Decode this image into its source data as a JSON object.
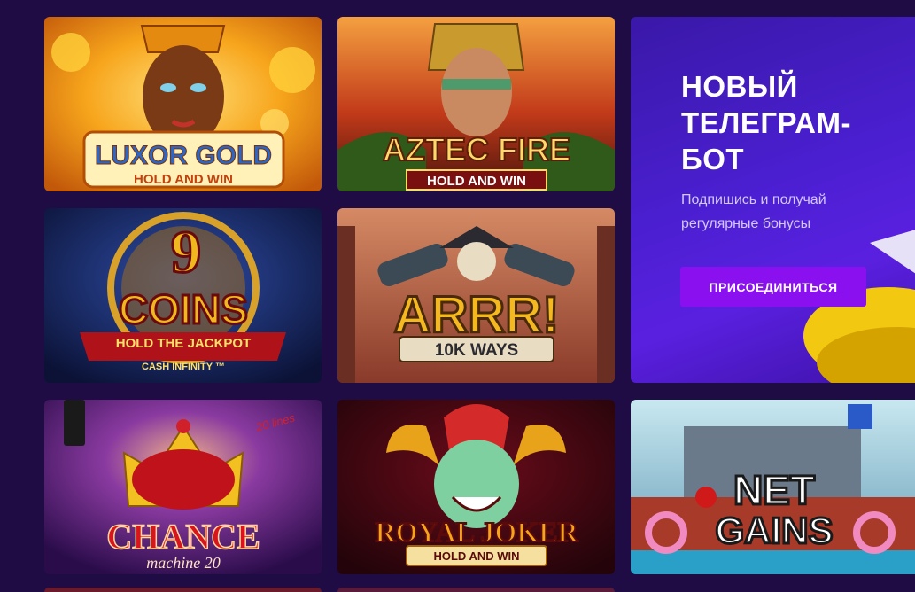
{
  "games": [
    {
      "id": "luxor-gold",
      "title": "LUXOR GOLD",
      "subtitle": "HOLD AND WIN"
    },
    {
      "id": "aztec-fire",
      "title": "AZTEC FIRE",
      "subtitle": "HOLD AND WIN"
    },
    {
      "id": "9-coins",
      "title_top": "9",
      "title": "COINS",
      "subtitle": "HOLD THE JACKPOT",
      "extra": "CASH INFINITY ™"
    },
    {
      "id": "arrr",
      "title": "ARRR!",
      "subtitle": "10K WAYS"
    },
    {
      "id": "chance-machine-20",
      "title": "CHANCE",
      "subtitle": "machine 20",
      "badge": "20 lines"
    },
    {
      "id": "royal-joker",
      "title": "ROYAL JOKER",
      "subtitle": "HOLD AND WIN"
    },
    {
      "id": "net-gains",
      "title_top": "NET",
      "title": "GAINS"
    }
  ],
  "promo": {
    "title": "НОВЫЙ\nТЕЛЕГРАМ-\nБОТ",
    "subtitle": "Подпишись и получай\nрегулярные бонусы",
    "button": "ПРИСОЕДИНИТЬСЯ"
  },
  "colors": {
    "background": "#1f0c45",
    "promo_gradient_from": "#3a18a8",
    "promo_gradient_to": "#5a20e0",
    "button": "#8a10f0"
  }
}
